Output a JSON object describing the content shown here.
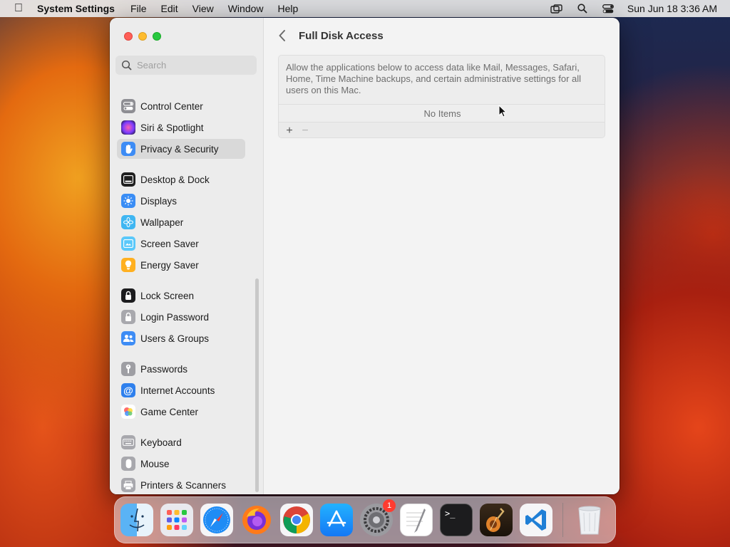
{
  "menubar": {
    "app_name": "System Settings",
    "menus": [
      "File",
      "Edit",
      "View",
      "Window",
      "Help"
    ],
    "clock": "Sun Jun 18  3:36 AM"
  },
  "sidebar": {
    "search_placeholder": "Search",
    "items": [
      {
        "label": "Control Center",
        "icon": "control-center-icon"
      },
      {
        "label": "Siri & Spotlight",
        "icon": "siri-icon"
      },
      {
        "label": "Privacy & Security",
        "icon": "hand-icon",
        "selected": true
      },
      {
        "label": "Desktop & Dock",
        "icon": "dock-icon"
      },
      {
        "label": "Displays",
        "icon": "sun-icon"
      },
      {
        "label": "Wallpaper",
        "icon": "flower-icon"
      },
      {
        "label": "Screen Saver",
        "icon": "screen-saver-icon"
      },
      {
        "label": "Energy Saver",
        "icon": "lightbulb-icon"
      },
      {
        "label": "Lock Screen",
        "icon": "lock-icon"
      },
      {
        "label": "Login Password",
        "icon": "padlock-icon"
      },
      {
        "label": "Users & Groups",
        "icon": "users-icon"
      },
      {
        "label": "Passwords",
        "icon": "key-icon"
      },
      {
        "label": "Internet Accounts",
        "icon": "at-icon"
      },
      {
        "label": "Game Center",
        "icon": "game-center-icon"
      },
      {
        "label": "Keyboard",
        "icon": "keyboard-icon"
      },
      {
        "label": "Mouse",
        "icon": "mouse-icon"
      },
      {
        "label": "Printers & Scanners",
        "icon": "printer-icon"
      }
    ]
  },
  "main": {
    "title": "Full Disk Access",
    "description": "Allow the applications below to access data like Mail, Messages, Safari, Home, Time Machine backups, and certain administrative settings for all users on this Mac.",
    "empty_text": "No Items",
    "add_label": "+",
    "remove_label": "−"
  },
  "dock": {
    "apps": [
      "Finder",
      "Launchpad",
      "Safari",
      "Firefox",
      "Chrome",
      "App Store",
      "System Settings",
      "TextEdit",
      "Terminal",
      "GarageBand",
      "VS Code"
    ],
    "settings_badge": "1",
    "trash": "Trash"
  }
}
